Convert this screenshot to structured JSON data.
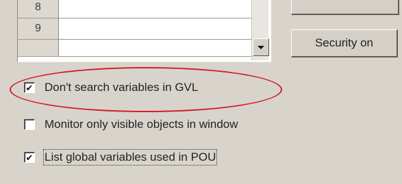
{
  "grid": {
    "rows": [
      {
        "number": "8",
        "value": ""
      },
      {
        "number": "9",
        "value": ""
      },
      {
        "number": "",
        "value": ""
      }
    ]
  },
  "buttons": {
    "security_on_label": "Security on"
  },
  "options": [
    {
      "label": "Don't search variables in GVL",
      "checked": true,
      "checkmark": "✔",
      "highlighted": true
    },
    {
      "label": "Monitor only visible objects in window",
      "checked": false,
      "checkmark": ""
    },
    {
      "label": "List global variables used in POU",
      "checked": true,
      "checkmark": "✔",
      "focused": true
    }
  ],
  "colors": {
    "background": "#d8d4cc",
    "highlight_ellipse": "#d21e2b"
  }
}
